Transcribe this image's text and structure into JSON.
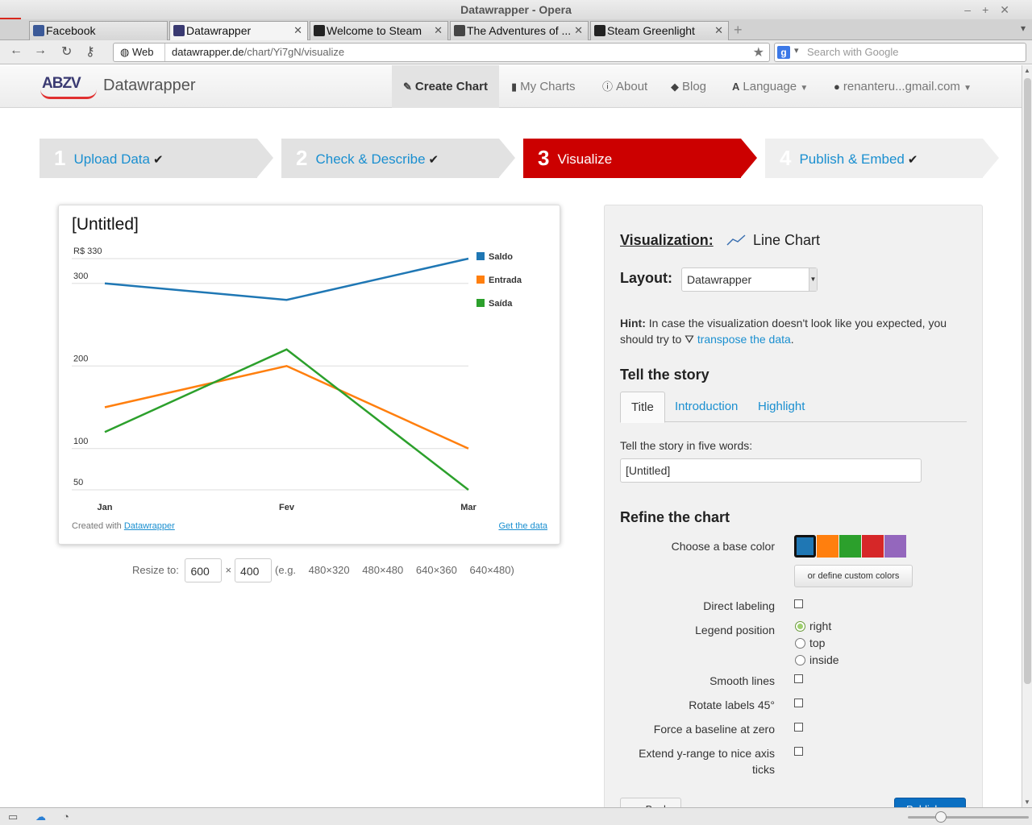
{
  "window": {
    "title": "Datawrapper - Opera"
  },
  "tabs": [
    {
      "label": "Facebook",
      "favicon_color": "#3b5998"
    },
    {
      "label": "Datawrapper",
      "favicon_color": "#3a3a72"
    },
    {
      "label": "Welcome to Steam",
      "favicon_color": "#222222"
    },
    {
      "label": "The Adventures of ...",
      "favicon_color": "#444444"
    },
    {
      "label": "Steam Greenlight",
      "favicon_color": "#222222"
    }
  ],
  "navbar": {
    "web_label": "Web",
    "url_host": "datawrapper.de",
    "url_path": "/chart/Yi7gN/visualize",
    "search_placeholder": "Search with Google"
  },
  "site": {
    "logo": "ABZV",
    "brand": "Datawrapper",
    "menu": [
      {
        "label": "Create Chart",
        "icon": "pencil-icon"
      },
      {
        "label": "My Charts",
        "icon": "bar-chart-icon"
      },
      {
        "label": "About",
        "icon": "info-icon"
      },
      {
        "label": "Blog",
        "icon": "tag-icon"
      },
      {
        "label": "Language",
        "icon": "font-icon"
      },
      {
        "label": "renanteru...gmail.com",
        "icon": "user-icon"
      }
    ]
  },
  "steps": [
    {
      "num": "1",
      "label": "Upload Data",
      "done": "✔"
    },
    {
      "num": "2",
      "label": "Check & Describe",
      "done": "✔"
    },
    {
      "num": "3",
      "label": "Visualize",
      "done": ""
    },
    {
      "num": "4",
      "label": "Publish & Embed",
      "done": "✔"
    }
  ],
  "chart_data": {
    "type": "line",
    "title": "[Untitled]",
    "categories": [
      "Jan",
      "Fev",
      "Mar"
    ],
    "series": [
      {
        "name": "Saldo",
        "values": [
          300,
          280,
          330
        ],
        "color": "#1f77b4"
      },
      {
        "name": "Entrada",
        "values": [
          150,
          200,
          100
        ],
        "color": "#ff7f0e"
      },
      {
        "name": "Saída",
        "values": [
          120,
          220,
          50
        ],
        "color": "#2ca02c"
      }
    ],
    "yticks": [
      {
        "value": 330,
        "label": "R$ 330"
      },
      {
        "value": 300,
        "label": "300"
      },
      {
        "value": 200,
        "label": "200"
      },
      {
        "value": 100,
        "label": "100"
      },
      {
        "value": 50,
        "label": "50"
      }
    ],
    "ylim": [
      50,
      330
    ],
    "legend": "right",
    "grid": true
  },
  "chart_footer": {
    "created_with": "Created with",
    "created_link": "Datawrapper",
    "get_data": "Get the data"
  },
  "resize": {
    "label": "Resize to:",
    "width": "600",
    "times": "×",
    "height": "400",
    "eg": "(e.g.",
    "presets": [
      "480×320",
      "480×480",
      "640×360",
      "640×480)"
    ]
  },
  "panel": {
    "vis_label": "Visualization:",
    "vis_value": "Line Chart",
    "layout_label": "Layout:",
    "layout_value": "Datawrapper",
    "hint_bold": "Hint:",
    "hint_text": "In case the visualization doesn't look like you expected, you should try to",
    "hint_link": "transpose the data",
    "hint_end": ".",
    "story_heading": "Tell the story",
    "story_tabs": [
      "Title",
      "Introduction",
      "Highlight"
    ],
    "five_words_label": "Tell the story in five words:",
    "title_value": "[Untitled]",
    "refine_heading": "Refine the chart",
    "base_color_label": "Choose a base color",
    "swatches": [
      "#1f77b4",
      "#ff7f0e",
      "#2ca02c",
      "#d62728",
      "#9467bd"
    ],
    "custom_colors": "or define custom colors",
    "direct_labeling": "Direct labeling",
    "legend_position": "Legend position",
    "legend_options": [
      "right",
      "top",
      "inside"
    ],
    "legend_selected": "right",
    "smooth_lines": "Smooth lines",
    "rotate_labels": "Rotate labels 45°",
    "force_baseline": "Force a baseline at zero",
    "extend_yrange_1": "Extend y-range to nice axis",
    "extend_yrange_2": "ticks",
    "back_button": "← Back",
    "publish_button": "Publish →"
  }
}
